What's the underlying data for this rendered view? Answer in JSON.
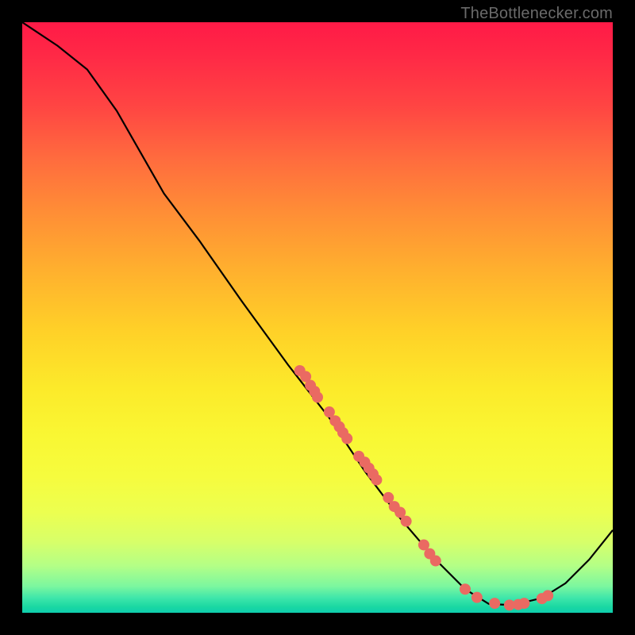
{
  "watermark": "TheBottlenecker.com",
  "chart_data": {
    "type": "line",
    "title": "",
    "xlabel": "",
    "ylabel": "",
    "xlim": [
      0,
      100
    ],
    "ylim": [
      0,
      100
    ],
    "curve": [
      {
        "x": 0,
        "y": 100
      },
      {
        "x": 6,
        "y": 96
      },
      {
        "x": 11,
        "y": 92
      },
      {
        "x": 16,
        "y": 85
      },
      {
        "x": 20,
        "y": 78
      },
      {
        "x": 24,
        "y": 71
      },
      {
        "x": 30,
        "y": 63
      },
      {
        "x": 37,
        "y": 53
      },
      {
        "x": 45,
        "y": 42
      },
      {
        "x": 52,
        "y": 33
      },
      {
        "x": 58,
        "y": 24
      },
      {
        "x": 64,
        "y": 16
      },
      {
        "x": 70,
        "y": 9
      },
      {
        "x": 75,
        "y": 4
      },
      {
        "x": 79,
        "y": 1.5
      },
      {
        "x": 83,
        "y": 1.3
      },
      {
        "x": 88,
        "y": 2.5
      },
      {
        "x": 92,
        "y": 5
      },
      {
        "x": 96,
        "y": 9
      },
      {
        "x": 100,
        "y": 14
      }
    ],
    "points": [
      {
        "x": 47,
        "y": 41
      },
      {
        "x": 48,
        "y": 40
      },
      {
        "x": 48.8,
        "y": 38.5
      },
      {
        "x": 49.5,
        "y": 37.5
      },
      {
        "x": 50,
        "y": 36.5
      },
      {
        "x": 52,
        "y": 34
      },
      {
        "x": 53,
        "y": 32.5
      },
      {
        "x": 53.7,
        "y": 31.5
      },
      {
        "x": 54.3,
        "y": 30.5
      },
      {
        "x": 55,
        "y": 29.5
      },
      {
        "x": 57,
        "y": 26.5
      },
      {
        "x": 58,
        "y": 25.5
      },
      {
        "x": 58.7,
        "y": 24.5
      },
      {
        "x": 59.4,
        "y": 23.5
      },
      {
        "x": 60,
        "y": 22.5
      },
      {
        "x": 62,
        "y": 19.5
      },
      {
        "x": 63,
        "y": 18
      },
      {
        "x": 64,
        "y": 17
      },
      {
        "x": 65,
        "y": 15.5
      },
      {
        "x": 68,
        "y": 11.5
      },
      {
        "x": 69,
        "y": 10
      },
      {
        "x": 70,
        "y": 8.8
      },
      {
        "x": 75,
        "y": 4
      },
      {
        "x": 77,
        "y": 2.6
      },
      {
        "x": 80,
        "y": 1.6
      },
      {
        "x": 82.5,
        "y": 1.3
      },
      {
        "x": 84,
        "y": 1.4
      },
      {
        "x": 85,
        "y": 1.6
      },
      {
        "x": 88,
        "y": 2.4
      },
      {
        "x": 89,
        "y": 2.9
      }
    ],
    "point_color": "#ea6a62",
    "curve_color": "#000000"
  }
}
